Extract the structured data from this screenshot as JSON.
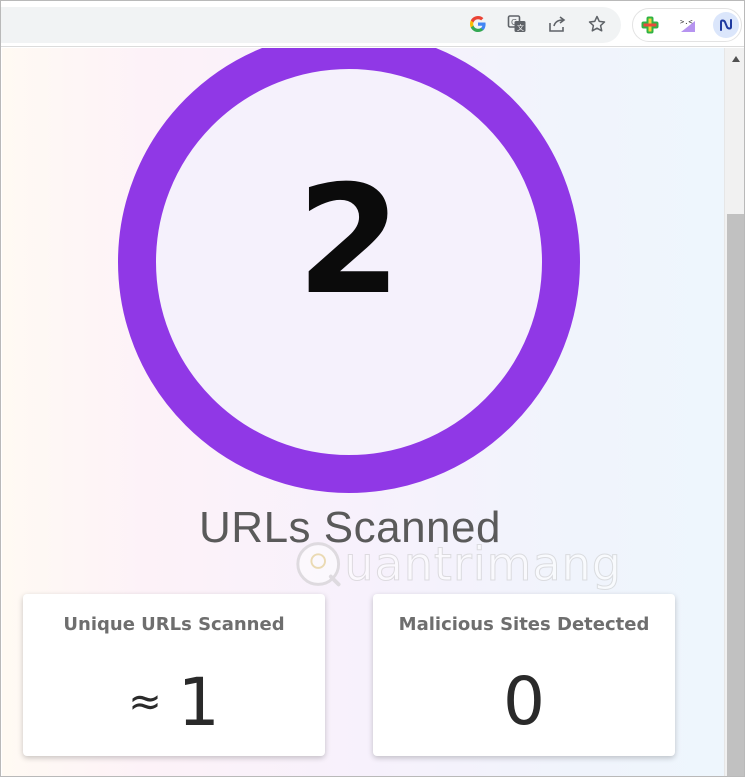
{
  "toolbar": {
    "icons": [
      "google-icon",
      "translate-icon",
      "share-icon",
      "bookmark-star-icon",
      "extension-plus-icon",
      "extension-cat-icon",
      "extension-nu-icon"
    ]
  },
  "stats": {
    "total_count": "2",
    "total_label": "URLs Scanned"
  },
  "watermark": {
    "text": "uantrimang"
  },
  "cards": [
    {
      "title": "Unique URLs Scanned",
      "prefix": "≈",
      "value": "1"
    },
    {
      "title": "Malicious Sites Detected",
      "prefix": "",
      "value": "0"
    }
  ],
  "colors": {
    "ring": "#9038e6",
    "label": "#5a5a5a",
    "card_title": "#6e6e6e"
  }
}
